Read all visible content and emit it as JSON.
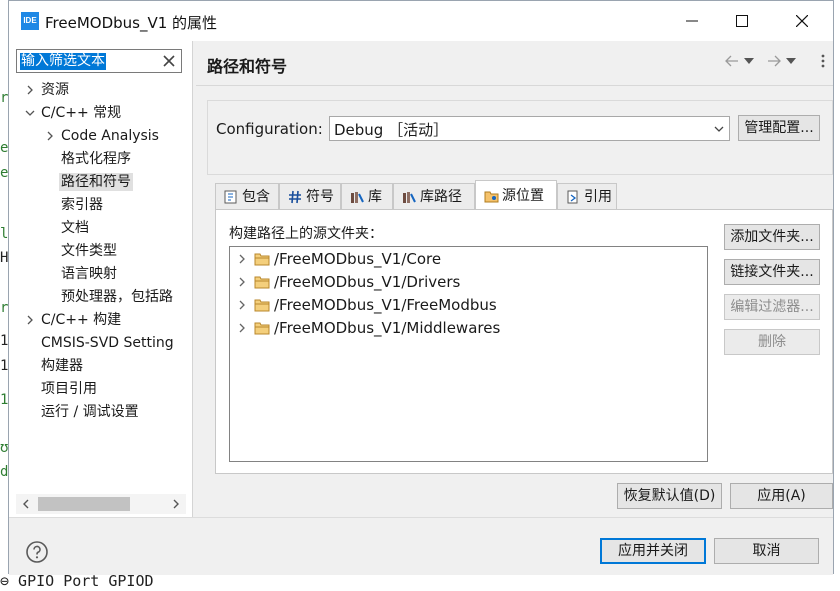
{
  "window": {
    "icon_text": "IDE",
    "title": "FreeMODbus_V1 的属性"
  },
  "filter": {
    "text": "输入筛选文本"
  },
  "tree": [
    {
      "label": "资源",
      "level": 0,
      "arrow": "right"
    },
    {
      "label": "C/C++ 常规",
      "level": 0,
      "arrow": "down"
    },
    {
      "label": "Code Analysis",
      "level": 1,
      "arrow": "right"
    },
    {
      "label": "格式化程序",
      "level": 1,
      "arrow": ""
    },
    {
      "label": "路径和符号",
      "level": 1,
      "arrow": "",
      "selected": true
    },
    {
      "label": "索引器",
      "level": 1,
      "arrow": ""
    },
    {
      "label": "文档",
      "level": 1,
      "arrow": ""
    },
    {
      "label": "文件类型",
      "level": 1,
      "arrow": ""
    },
    {
      "label": "语言映射",
      "level": 1,
      "arrow": ""
    },
    {
      "label": "预处理器，包括路",
      "level": 1,
      "arrow": ""
    },
    {
      "label": "C/C++ 构建",
      "level": 0,
      "arrow": "right"
    },
    {
      "label": "CMSIS-SVD Setting",
      "level": 0,
      "arrow": ""
    },
    {
      "label": "构建器",
      "level": 0,
      "arrow": ""
    },
    {
      "label": "项目引用",
      "level": 0,
      "arrow": ""
    },
    {
      "label": "运行 / 调试设置",
      "level": 0,
      "arrow": ""
    }
  ],
  "page": {
    "title": "路径和符号",
    "configuration_label": "Configuration:",
    "configuration_value": "Debug ［活动］",
    "manage_button": "管理配置..."
  },
  "tabs": [
    {
      "label": "包含",
      "icon": "include-icon"
    },
    {
      "label": "符号",
      "icon": "hash-icon"
    },
    {
      "label": "库",
      "icon": "library-icon"
    },
    {
      "label": "库路径",
      "icon": "library-path-icon"
    },
    {
      "label": "源位置",
      "icon": "source-folder-icon",
      "active": true
    },
    {
      "label": "引用",
      "icon": "reference-icon"
    }
  ],
  "panel": {
    "label": "构建路径上的源文件夹：",
    "folders": [
      "/FreeMODbus_V1/Core",
      "/FreeMODbus_V1/Drivers",
      "/FreeMODbus_V1/FreeModbus",
      "/FreeMODbus_V1/Middlewares"
    ],
    "buttons": {
      "add": "添加文件夹...",
      "link": "链接文件夹...",
      "edit": "编辑过滤器...",
      "delete": "删除"
    }
  },
  "actions": {
    "restore": "恢复默认值(D)",
    "apply": "应用(A)",
    "apply_close": "应用并关闭",
    "cancel": "取消"
  },
  "background": {
    "bottom_text": "⊖ GPIO Port GPIOD",
    "left_chars": [
      "r",
      "e",
      "e",
      "l",
      "H",
      "r",
      "1",
      "1",
      "1",
      "ʊ",
      "d"
    ]
  }
}
